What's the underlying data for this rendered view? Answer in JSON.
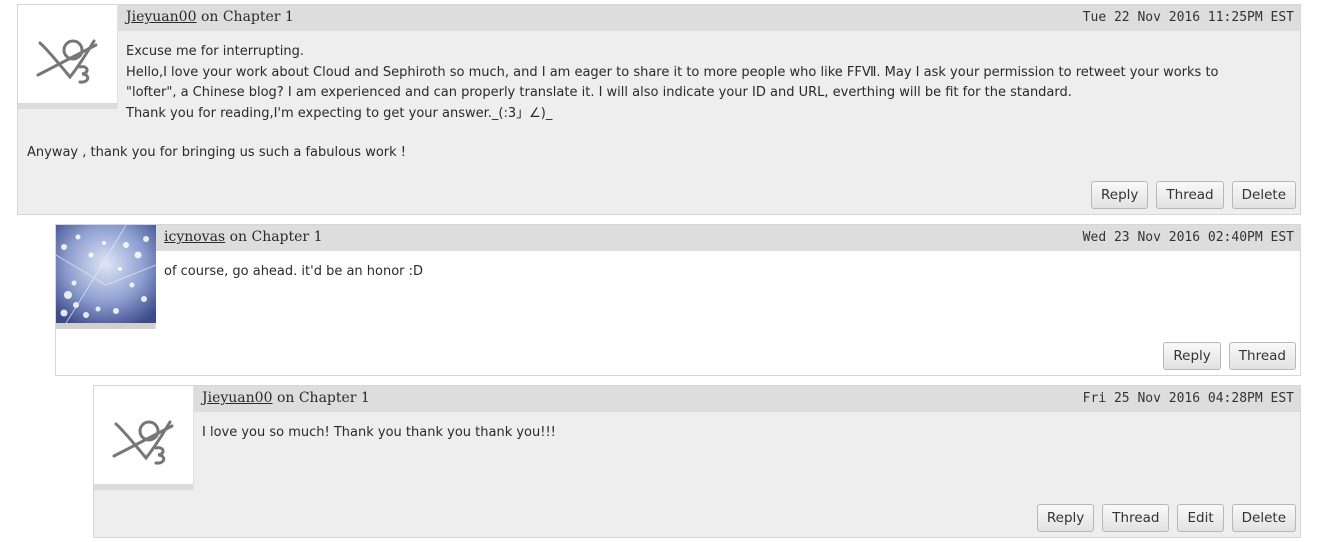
{
  "comments": [
    {
      "username": "Jieyuan00",
      "on_text": "on",
      "chapter": "Chapter 1",
      "datetime": "Tue 22 Nov 2016 11:25PM EST",
      "avatar": "default-crossed-avatar-icon",
      "body": [
        "Excuse me for interrupting.",
        "Hello,I love your work about Cloud and Sephiroth so much, and I am eager to share it to more people who like FFⅦ. May I ask your permission to retweet your works to",
        "\"lofter\", a Chinese blog? I am experienced and can properly translate it. I will also indicate your ID and URL, everthing will be fit for the standard.",
        "Thank you for reading,I'm expecting to get your answer._(:3」∠)_",
        "Anyway , thank you for bringing us such a fabulous work !"
      ],
      "buttons": [
        "Reply",
        "Thread",
        "Delete"
      ]
    },
    {
      "username": "icynovas",
      "on_text": "on",
      "chapter": "Chapter 1",
      "datetime": "Wed 23 Nov 2016 02:40PM EST",
      "avatar": "blue-blossom-avatar-image",
      "body": [
        "of course, go ahead. it'd be an honor :D"
      ],
      "buttons": [
        "Reply",
        "Thread"
      ]
    },
    {
      "username": "Jieyuan00",
      "on_text": "on",
      "chapter": "Chapter 1",
      "datetime": "Fri 25 Nov 2016 04:28PM EST",
      "avatar": "default-crossed-avatar-icon",
      "body": [
        "I love you so much! Thank you thank you thank you!!!"
      ],
      "buttons": [
        "Reply",
        "Thread",
        "Edit",
        "Delete"
      ]
    }
  ]
}
